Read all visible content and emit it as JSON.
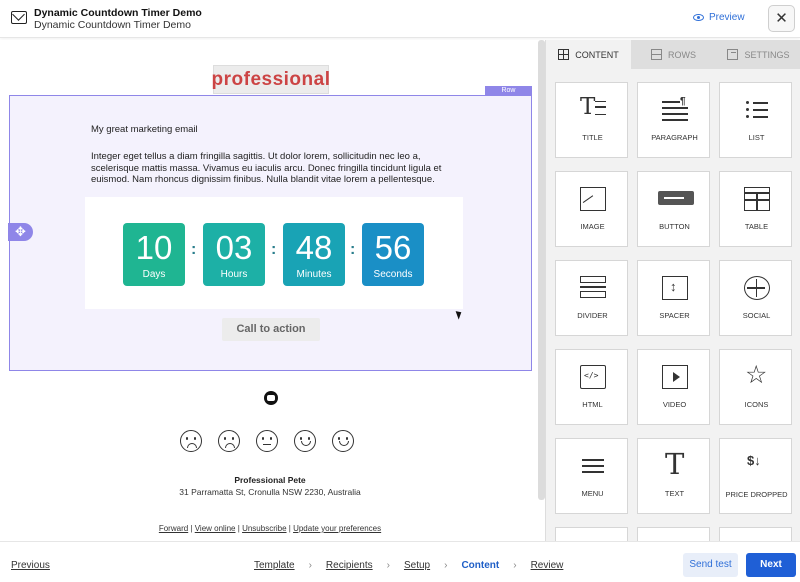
{
  "header": {
    "title": "Dynamic Countdown Timer Demo",
    "subtitle": "Dynamic Countdown Timer Demo",
    "preview_label": "Preview",
    "close_label": "✕"
  },
  "email": {
    "logo_text": "professional",
    "row_tag": "Row",
    "drag_icon": "✥",
    "heading": "My great marketing email",
    "body": "Integer eget tellus a diam fringilla sagittis. Ut dolor lorem, sollicitudin nec leo a, scelerisque mattis massa. Vivamus eu iaculis arcu. Donec fringilla tincidunt ligula et euismod. Nam rhoncus dignissim finibus. Nulla blandit vitae lorem a pellentesque.",
    "countdown": [
      {
        "value": "10",
        "label": "Days",
        "color": "#1fb592"
      },
      {
        "value": "03",
        "label": "Hours",
        "color": "#1db0a6"
      },
      {
        "value": "48",
        "label": "Minutes",
        "color": "#19a3b5"
      },
      {
        "value": "56",
        "label": "Seconds",
        "color": "#1a8fc6"
      }
    ],
    "cta_label": "Call to action",
    "footer_name": "Professional Pete",
    "footer_address": "31 Parramatta St, Cronulla NSW 2230, Australia",
    "footer_links": [
      "Forward",
      "View online",
      "Unsubscribe",
      "Update your preferences"
    ],
    "footer_sep": "|"
  },
  "panel": {
    "tabs": [
      {
        "label": "CONTENT",
        "icon": "grid-icon"
      },
      {
        "label": "ROWS",
        "icon": "rows-icon"
      },
      {
        "label": "SETTINGS",
        "icon": "settings-icon"
      }
    ],
    "blocks": [
      {
        "label": "TITLE",
        "icon": "title-icon"
      },
      {
        "label": "PARAGRAPH",
        "icon": "paragraph-icon"
      },
      {
        "label": "LIST",
        "icon": "list-icon"
      },
      {
        "label": "IMAGE",
        "icon": "image-icon"
      },
      {
        "label": "BUTTON",
        "icon": "button-icon"
      },
      {
        "label": "TABLE",
        "icon": "table-icon"
      },
      {
        "label": "DIVIDER",
        "icon": "divider-icon"
      },
      {
        "label": "SPACER",
        "icon": "spacer-icon"
      },
      {
        "label": "SOCIAL",
        "icon": "social-icon"
      },
      {
        "label": "HTML",
        "icon": "html-icon"
      },
      {
        "label": "VIDEO",
        "icon": "video-icon"
      },
      {
        "label": "ICONS",
        "icon": "icons-icon"
      },
      {
        "label": "MENU",
        "icon": "menu-icon"
      },
      {
        "label": "TEXT",
        "icon": "text-icon"
      },
      {
        "label": "PRICE DROPPED",
        "icon": "price-dropped-icon"
      }
    ]
  },
  "footer": {
    "previous_label": "Previous",
    "steps": [
      {
        "label": "Template",
        "current": false
      },
      {
        "label": "Recipients",
        "current": false
      },
      {
        "label": "Setup",
        "current": false
      },
      {
        "label": "Content",
        "current": true
      },
      {
        "label": "Review",
        "current": false
      }
    ],
    "chevron": "›",
    "send_test_label": "Send test",
    "next_label": "Next"
  }
}
